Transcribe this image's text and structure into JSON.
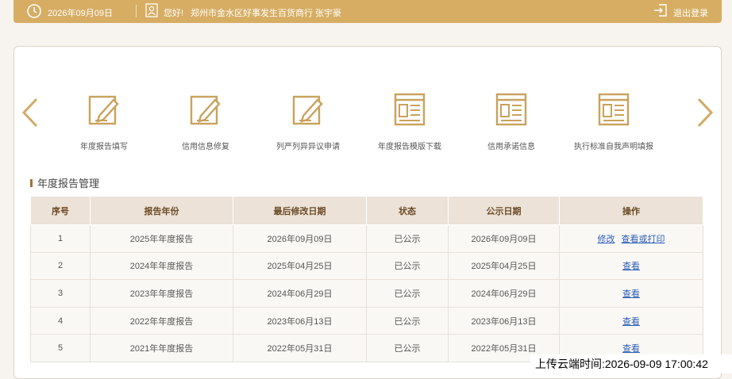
{
  "topbar": {
    "date": "2026年09月09日",
    "greeting": "您好!",
    "org": "郑州市金水区好事发生百货商行",
    "user": "张宇豪",
    "logout": "退出登录",
    "icons": {
      "clock": "clock-icon",
      "user": "user-card-icon",
      "logout": "logout-icon"
    }
  },
  "tiles": [
    {
      "label": "年度报告填写",
      "icon": "edit-form-icon"
    },
    {
      "label": "信用信息修复",
      "icon": "edit-form-icon"
    },
    {
      "label": "列严列异异议申请",
      "icon": "edit-form-icon"
    },
    {
      "label": "年度报告模版下载",
      "icon": "document-list-icon"
    },
    {
      "label": "信用承诺信息",
      "icon": "document-list-icon"
    },
    {
      "label": "执行标准自我声明填报",
      "icon": "document-list-icon"
    }
  ],
  "section": {
    "title": "年度报告管理"
  },
  "table": {
    "headers": [
      "序号",
      "报告年份",
      "最后修改日期",
      "状态",
      "公示日期",
      "操作"
    ],
    "rows": [
      {
        "no": "1",
        "year": "2025年年度报告",
        "modified": "2026年09月09日",
        "status": "已公示",
        "public": "2026年09月09日",
        "actions": [
          "修改",
          "查看或打印"
        ]
      },
      {
        "no": "2",
        "year": "2024年年度报告",
        "modified": "2025年04月25日",
        "status": "已公示",
        "public": "2025年04月25日",
        "actions": [
          "查看"
        ]
      },
      {
        "no": "3",
        "year": "2023年年度报告",
        "modified": "2024年06月29日",
        "status": "已公示",
        "public": "2024年06月29日",
        "actions": [
          "查看"
        ]
      },
      {
        "no": "4",
        "year": "2022年年度报告",
        "modified": "2023年06月13日",
        "status": "已公示",
        "public": "2023年06月13日",
        "actions": [
          "查看"
        ]
      },
      {
        "no": "5",
        "year": "2021年年度报告",
        "modified": "2022年05月31日",
        "status": "已公示",
        "public": "2022年05月31日",
        "actions": [
          "查看"
        ]
      }
    ]
  },
  "footer": {
    "timestamp": "上传云端时间:2026-09-09 17:00:42"
  },
  "colors": {
    "accent": "#d6ad63",
    "header_bg": "#ece2d7",
    "link": "#2b5db8"
  }
}
